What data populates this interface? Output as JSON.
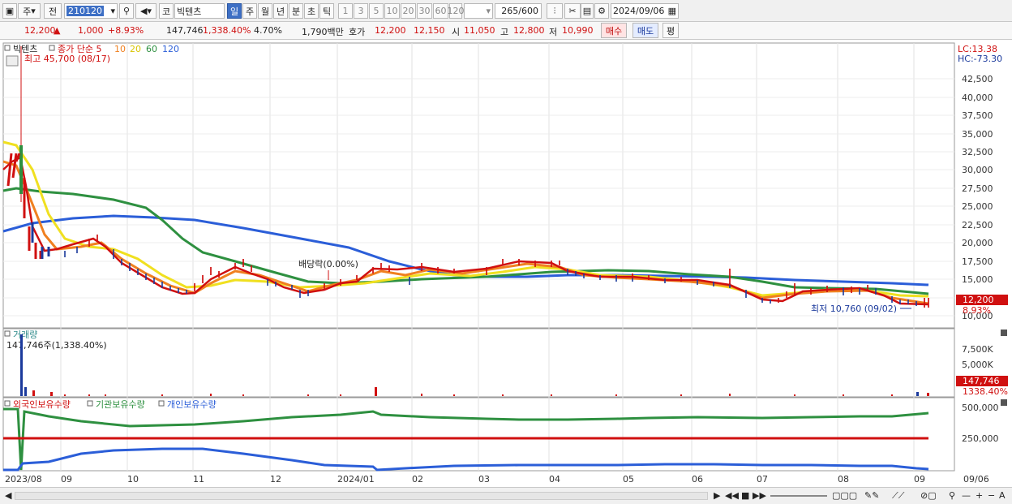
{
  "toolbar": {
    "period_labels": [
      "주",
      "전"
    ],
    "code": "210120",
    "market": "코",
    "name": "빅텐츠",
    "timeframes": [
      "일",
      "주",
      "월",
      "년",
      "분",
      "초",
      "틱"
    ],
    "intervals": [
      "1",
      "3",
      "5",
      "10",
      "20",
      "30",
      "60",
      "120"
    ],
    "count": "265",
    "count_max": "/600",
    "date": "2024/09/06"
  },
  "quote": {
    "price": "12,200",
    "change_arrow": "▲",
    "change": "1,000",
    "change_pct": "+8.93%",
    "volume": "147,746",
    "volume_ratio": "1,338.40%",
    "turnover_rate": "4.70%",
    "amount": "1,790백만",
    "hoga_label": "호가",
    "ask": "12,200",
    "bid": "12,150",
    "open_label": "시",
    "open": "11,050",
    "high_label": "고",
    "high": "12,800",
    "low_label": "저",
    "low": "10,990",
    "buy_label": "매수",
    "sell_label": "매도",
    "eval_label": "평"
  },
  "price_panel": {
    "legend_name": "빅텐츠",
    "legend_ma": "종가 단순 5",
    "ma10": "10",
    "ma20": "20",
    "ma60": "60",
    "ma120": "120",
    "high_annot": "최고 45,700 (08/17)",
    "low_annot": "최저 10,760 (09/02)",
    "dividend_annot": "배당락(0.00%)",
    "lc": "LC:13.38",
    "hc": "HC:-73.30",
    "current_price": "12,200",
    "current_pct": "8.93%",
    "y_ticks": [
      "42,500",
      "40,000",
      "37,500",
      "35,000",
      "32,500",
      "30,000",
      "27,500",
      "25,000",
      "22,500",
      "20,000",
      "17,500",
      "15,000",
      "12,500",
      "10,000"
    ]
  },
  "volume_panel": {
    "title": "거래량",
    "info": "147,746주(1,338.40%)",
    "y_ticks": [
      "7,500K",
      "5,000K"
    ],
    "current": "147,746",
    "current_pct": "1338.40%"
  },
  "holding_panel": {
    "legend_foreign": "외국인보유수량",
    "legend_inst": "기관보유수량",
    "legend_indiv": "개인보유수량",
    "y_ticks": [
      "500,000",
      "250,000"
    ]
  },
  "x_axis": [
    "2023/08",
    "09",
    "10",
    "11",
    "12",
    "2024/01",
    "02",
    "03",
    "04",
    "05",
    "06",
    "07",
    "08",
    "09"
  ],
  "x_axis_right": "09/06",
  "colors": {
    "ma5": "#d01010",
    "ma10": "#f08020",
    "ma20": "#f0e020",
    "ma60": "#2e9040",
    "ma120": "#2b5ed8",
    "up": "#d01010",
    "down": "#1b3a9c",
    "foreign": "#d01010",
    "inst": "#2e9040",
    "indiv": "#2b5ed8"
  },
  "chart_data": {
    "type": "line",
    "x_unit": "date",
    "ylim": [
      10000,
      45700
    ],
    "series": [
      {
        "name": "120",
        "values": [
          [
            0,
            21500
          ],
          [
            120,
            23500
          ],
          [
            200,
            23500
          ],
          [
            300,
            22500
          ],
          [
            400,
            20800
          ],
          [
            500,
            17800
          ],
          [
            600,
            16200
          ],
          [
            700,
            16200
          ],
          [
            800,
            15800
          ],
          [
            900,
            15300
          ],
          [
            1000,
            14800
          ],
          [
            1100,
            14700
          ],
          [
            1145,
            14300
          ]
        ]
      },
      {
        "name": "60",
        "values": [
          [
            0,
            27000
          ],
          [
            60,
            26500
          ],
          [
            150,
            25000
          ],
          [
            200,
            22500
          ],
          [
            250,
            19000
          ],
          [
            300,
            17200
          ],
          [
            400,
            15800
          ],
          [
            500,
            15300
          ],
          [
            600,
            15500
          ],
          [
            700,
            16000
          ],
          [
            800,
            15800
          ],
          [
            900,
            15500
          ],
          [
            950,
            14800
          ],
          [
            1000,
            14000
          ],
          [
            1100,
            13500
          ],
          [
            1145,
            13000
          ]
        ]
      }
    ]
  }
}
